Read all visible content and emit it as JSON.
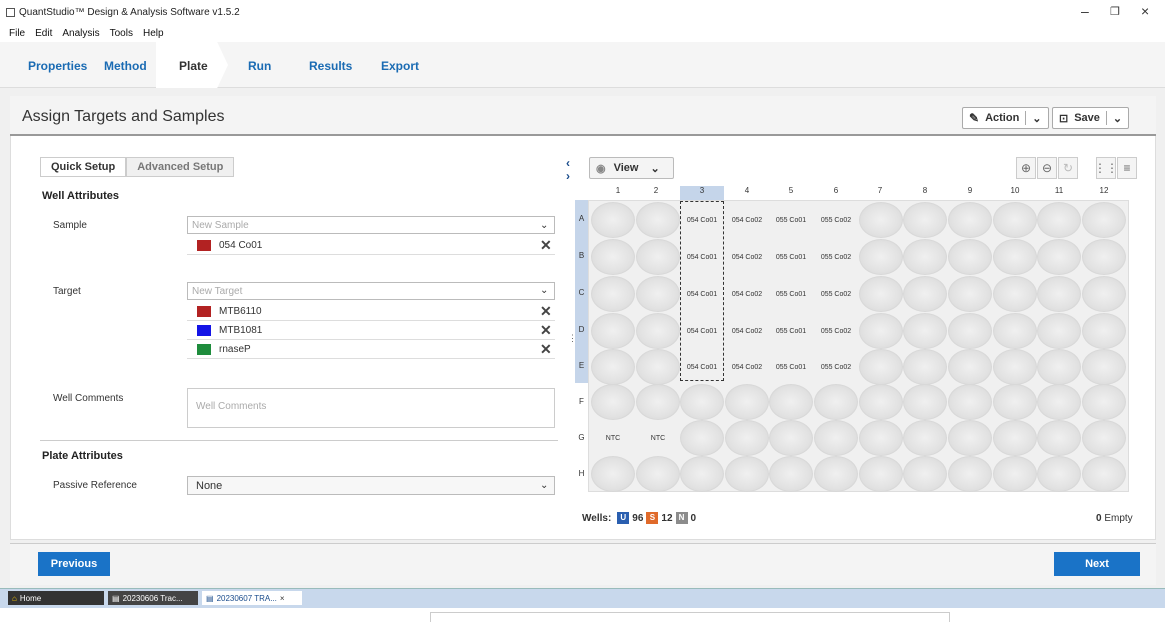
{
  "window": {
    "title": "QuantStudio™ Design & Analysis Software v1.5.2"
  },
  "menu": [
    "File",
    "Edit",
    "Analysis",
    "Tools",
    "Help"
  ],
  "nav_tabs": [
    "Properties",
    "Method",
    "Plate",
    "Run",
    "Results",
    "Export"
  ],
  "header": {
    "title": "Assign Targets and Samples",
    "action_label": "Action",
    "save_label": "Save"
  },
  "subtabs": [
    "Quick Setup",
    "Advanced Setup"
  ],
  "well_attributes": {
    "heading": "Well Attributes",
    "sample_label": "Sample",
    "sample_placeholder": "New Sample",
    "samples": [
      {
        "name": "054 Co01",
        "color": "#b22222"
      }
    ],
    "target_label": "Target",
    "target_placeholder": "New Target",
    "targets": [
      {
        "name": "MTB6110",
        "color": "#b22222"
      },
      {
        "name": "MTB1081",
        "color": "#1414e6"
      },
      {
        "name": "rnaseP",
        "color": "#1e8c3c"
      }
    ],
    "comments_label": "Well Comments",
    "comments_placeholder": "Well Comments"
  },
  "plate_attributes": {
    "heading": "Plate Attributes",
    "passive_label": "Passive Reference",
    "passive_value": "None"
  },
  "plate": {
    "view_label": "View",
    "columns": [
      "1",
      "2",
      "3",
      "4",
      "5",
      "6",
      "7",
      "8",
      "9",
      "10",
      "11",
      "12"
    ],
    "rows": [
      "A",
      "B",
      "C",
      "D",
      "E",
      "F",
      "G",
      "H"
    ],
    "selected_column": "3",
    "selected_rows": [
      "A",
      "B",
      "C",
      "D",
      "E"
    ],
    "wells": {
      "A": [
        "",
        "",
        "054 Co01",
        "054 Co02",
        "055 Co01",
        "055 Co02",
        "",
        "",
        "",
        "",
        "",
        ""
      ],
      "B": [
        "",
        "",
        "054 Co01",
        "054 Co02",
        "055 Co01",
        "055 Co02",
        "",
        "",
        "",
        "",
        "",
        ""
      ],
      "C": [
        "",
        "",
        "054 Co01",
        "054 Co02",
        "055 Co01",
        "055 Co02",
        "",
        "",
        "",
        "",
        "",
        ""
      ],
      "D": [
        "",
        "",
        "054 Co01",
        "054 Co02",
        "055 Co01",
        "055 Co02",
        "",
        "",
        "",
        "",
        "",
        ""
      ],
      "E": [
        "",
        "",
        "054 Co01",
        "054 Co02",
        "055 Co01",
        "055 Co02",
        "",
        "",
        "",
        "",
        "",
        ""
      ],
      "F": [
        "",
        "",
        "",
        "",
        "",
        "",
        "",
        "",
        "",
        "",
        "",
        ""
      ],
      "G": [
        "NTC",
        "NTC",
        "",
        "",
        "",
        "",
        "",
        "",
        "",
        "",
        "",
        ""
      ],
      "H": [
        "",
        "",
        "",
        "",
        "",
        "",
        "",
        "",
        "",
        "",
        "",
        ""
      ]
    }
  },
  "footer": {
    "wells_label": "Wells:",
    "u_badge": "U",
    "u_count": "96",
    "s_badge": "S",
    "s_count": "12",
    "n_badge": "N",
    "n_count": "0",
    "empty_count": "0",
    "empty_label": "Empty"
  },
  "buttons": {
    "previous": "Previous",
    "next": "Next"
  },
  "taskbar": [
    "Home",
    "20230606 Trac...",
    "20230607 TRA..."
  ],
  "colors": {
    "accent": "#1a73c7",
    "u_badge": "#2a5fb0",
    "s_badge": "#e06a2a",
    "n_badge": "#8c8c8c"
  }
}
